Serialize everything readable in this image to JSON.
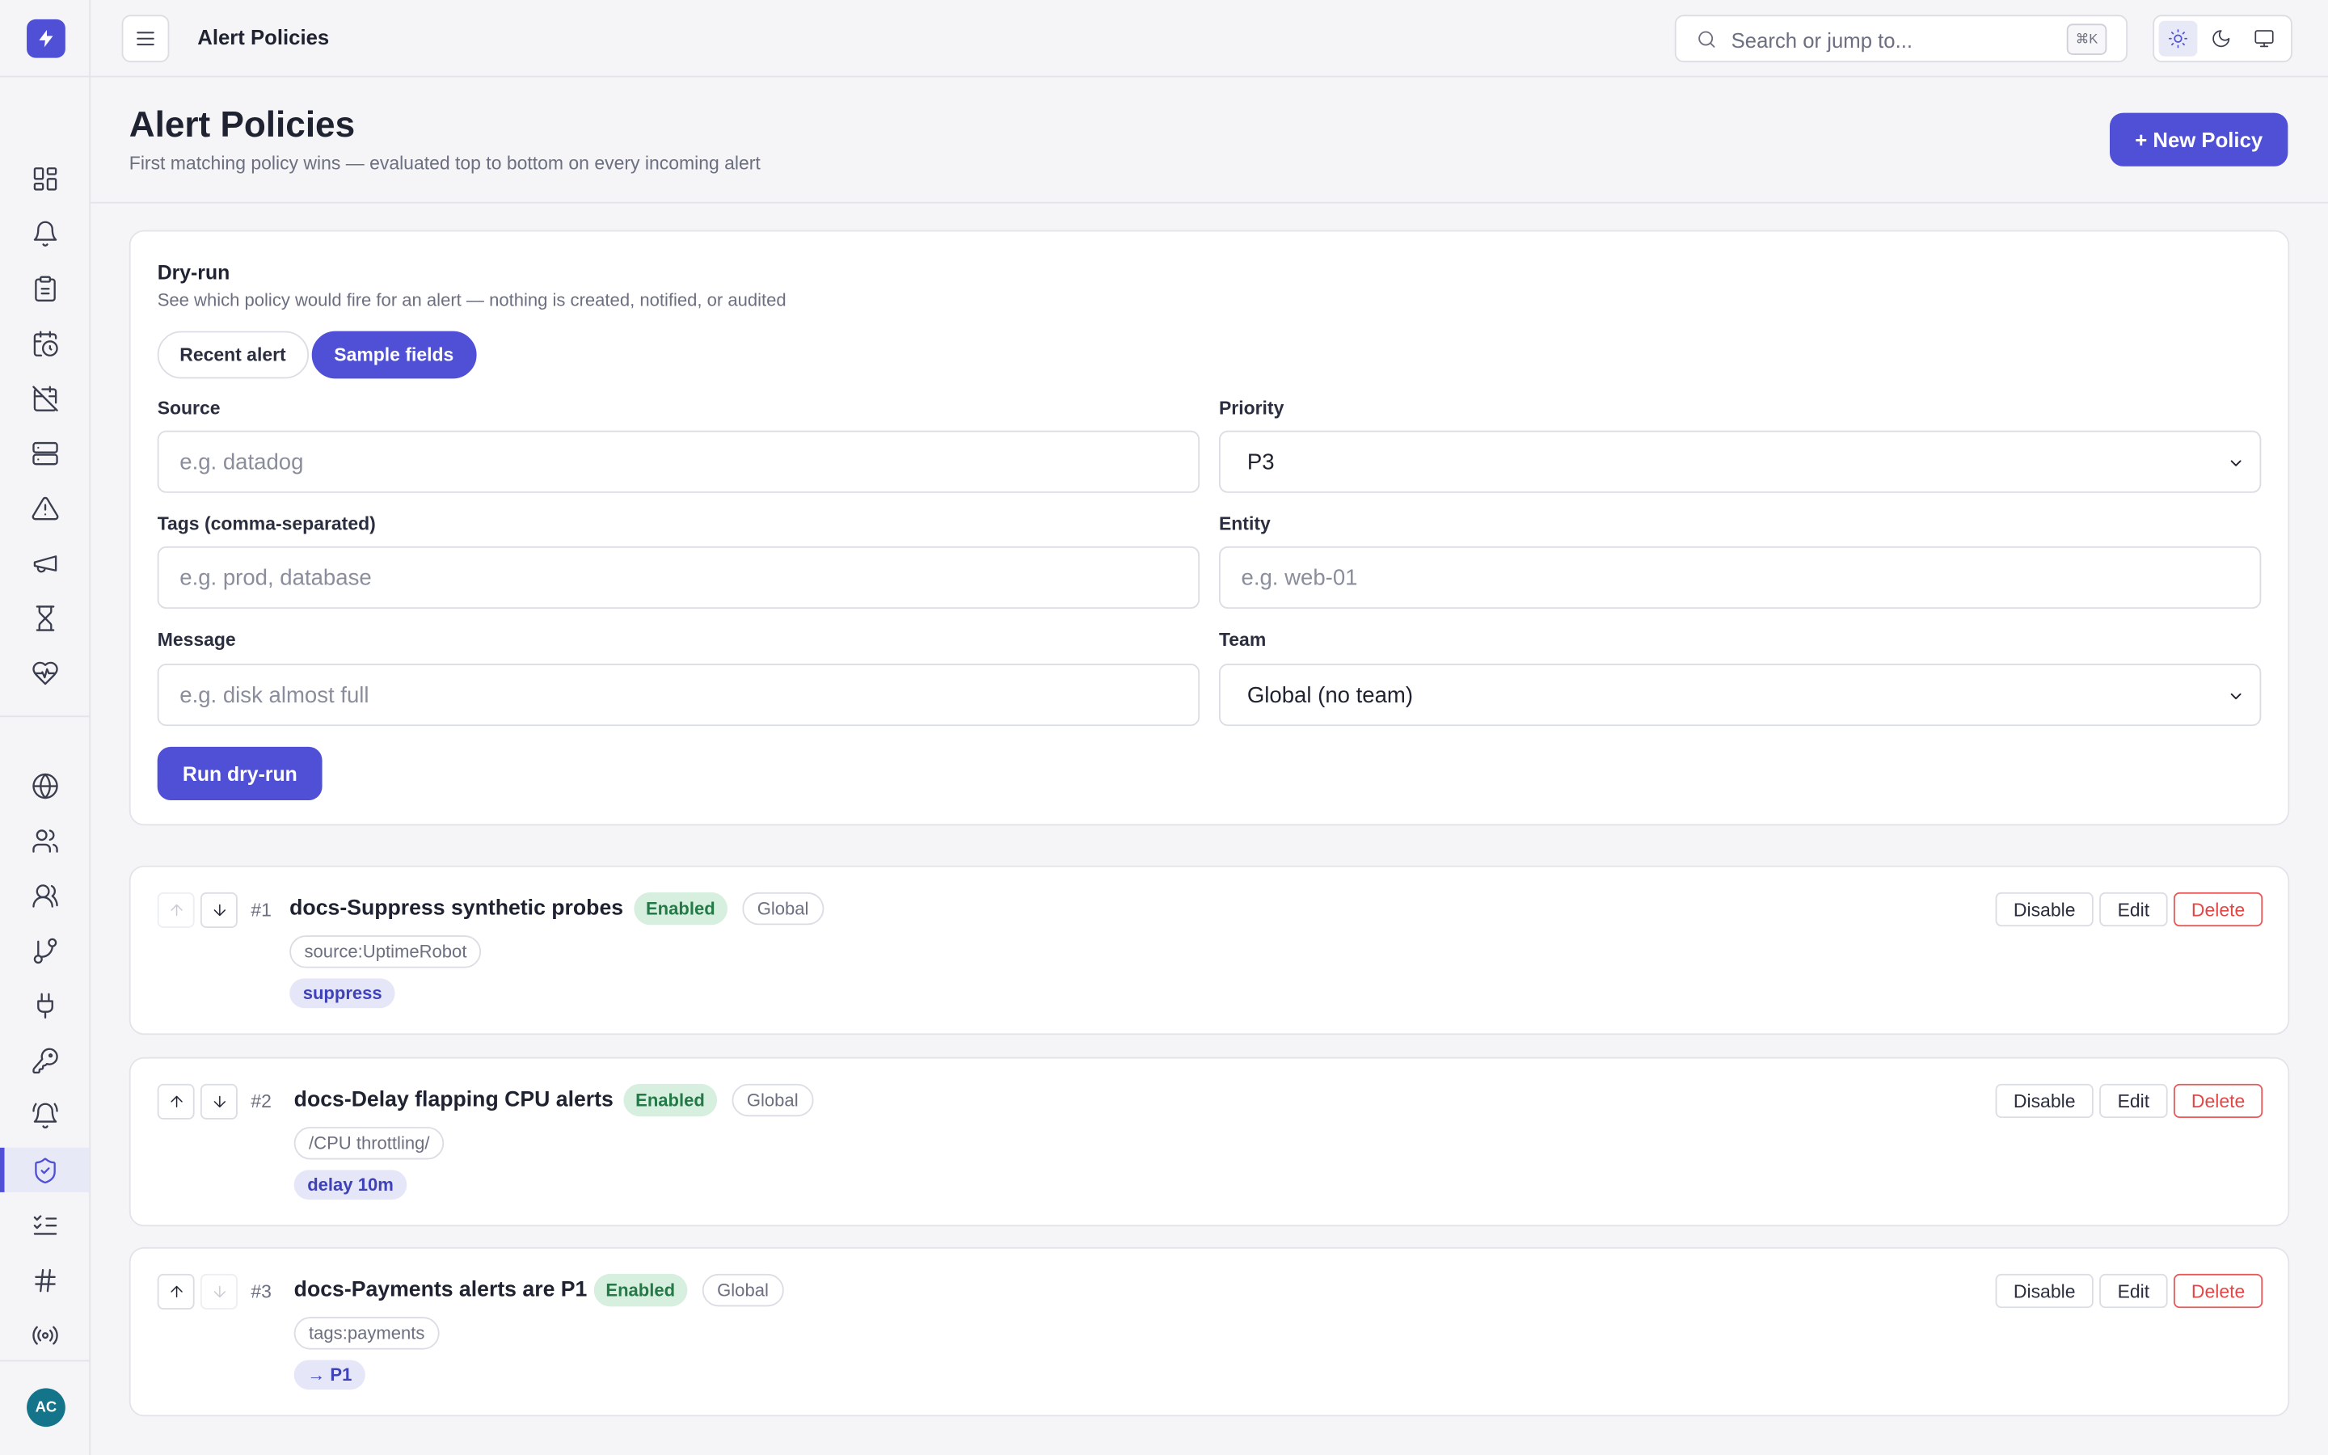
{
  "topbar": {
    "title": "Alert Policies",
    "search_placeholder": "Search or jump to...",
    "search_shortcut": "⌘K"
  },
  "sidebar": {
    "items": [
      {
        "icon": "dashboard-icon"
      },
      {
        "icon": "bell-icon"
      },
      {
        "icon": "clipboard-icon"
      },
      {
        "icon": "calendar-clock-icon"
      },
      {
        "icon": "calendar-off-icon"
      },
      {
        "icon": "server-icon"
      },
      {
        "icon": "warning-icon"
      },
      {
        "icon": "megaphone-icon"
      },
      {
        "icon": "hourglass-icon"
      },
      {
        "icon": "heart-pulse-icon"
      },
      {
        "icon": "globe-icon"
      },
      {
        "icon": "users-icon"
      },
      {
        "icon": "team-icon"
      },
      {
        "icon": "git-branch-icon"
      },
      {
        "icon": "plug-icon"
      },
      {
        "icon": "key-icon"
      },
      {
        "icon": "bell-ring-icon"
      },
      {
        "icon": "shield-check-icon",
        "active": true
      },
      {
        "icon": "checklist-icon"
      },
      {
        "icon": "hash-icon"
      },
      {
        "icon": "broadcast-icon"
      }
    ],
    "avatar": "AC"
  },
  "header": {
    "title": "Alert Policies",
    "subtitle": "First matching policy wins — evaluated top to bottom on every incoming alert",
    "new_button": "+ New Policy"
  },
  "dryrun": {
    "title": "Dry-run",
    "subtitle": "See which policy would fire for an alert — nothing is created, notified, or audited",
    "tabs": [
      "Recent alert",
      "Sample fields"
    ],
    "active_tab": "Sample fields",
    "fields": {
      "source": {
        "label": "Source",
        "placeholder": "e.g. datadog"
      },
      "priority": {
        "label": "Priority",
        "value": "P3"
      },
      "tags": {
        "label": "Tags (comma-separated)",
        "placeholder": "e.g. prod, database"
      },
      "entity": {
        "label": "Entity",
        "placeholder": "e.g. web-01"
      },
      "message": {
        "label": "Message",
        "placeholder": "e.g. disk almost full"
      },
      "team": {
        "label": "Team",
        "value": "Global (no team)"
      }
    },
    "run_button": "Run dry-run"
  },
  "policies": [
    {
      "num": "#1",
      "name": "docs-Suppress synthetic probes",
      "status": "Enabled",
      "scope": "Global",
      "condition": "source:UptimeRobot",
      "action": "suppress"
    },
    {
      "num": "#2",
      "name": "docs-Delay flapping CPU alerts",
      "status": "Enabled",
      "scope": "Global",
      "condition": "/CPU throttling/",
      "action": "delay 10m"
    },
    {
      "num": "#3",
      "name": "docs-Payments alerts are P1",
      "status": "Enabled",
      "scope": "Global",
      "condition": "tags:payments",
      "action": "→ P1"
    }
  ],
  "row_actions": {
    "disable": "Disable",
    "edit": "Edit",
    "delete": "Delete"
  },
  "colors": {
    "accent": "#4f50d6",
    "enabled_bg": "#d7efdf",
    "enabled_text": "#237a47",
    "danger": "#e04848"
  }
}
